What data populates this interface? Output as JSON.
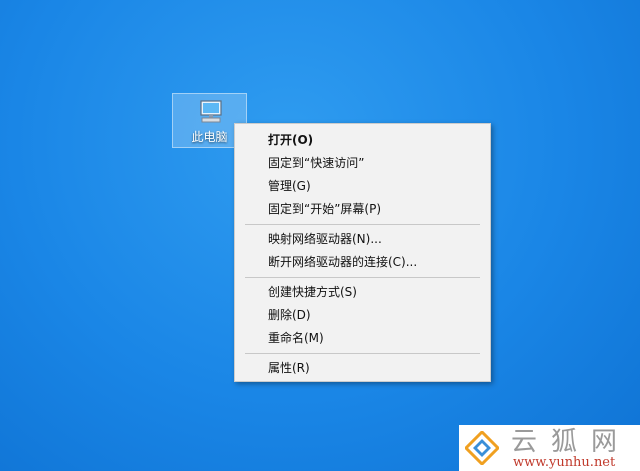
{
  "desktop": {
    "icon_label": "此电脑",
    "icon_name": "computer-icon"
  },
  "context_menu": {
    "groups": [
      [
        "打开(O)",
        "固定到“快速访问”",
        "管理(G)",
        "固定到“开始”屏幕(P)"
      ],
      [
        "映射网络驱动器(N)...",
        "断开网络驱动器的连接(C)..."
      ],
      [
        "创建快捷方式(S)",
        "删除(D)",
        "重命名(M)"
      ],
      [
        "属性(R)"
      ]
    ]
  },
  "watermark": {
    "brand_cn": "云狐网",
    "url": "www.yunhu.net",
    "logo_icon": "yunhu-logo-icon"
  },
  "colors": {
    "desktop_bg": "#1a86e6",
    "menu_bg": "#f2f2f2",
    "url_red": "#c0392b"
  }
}
